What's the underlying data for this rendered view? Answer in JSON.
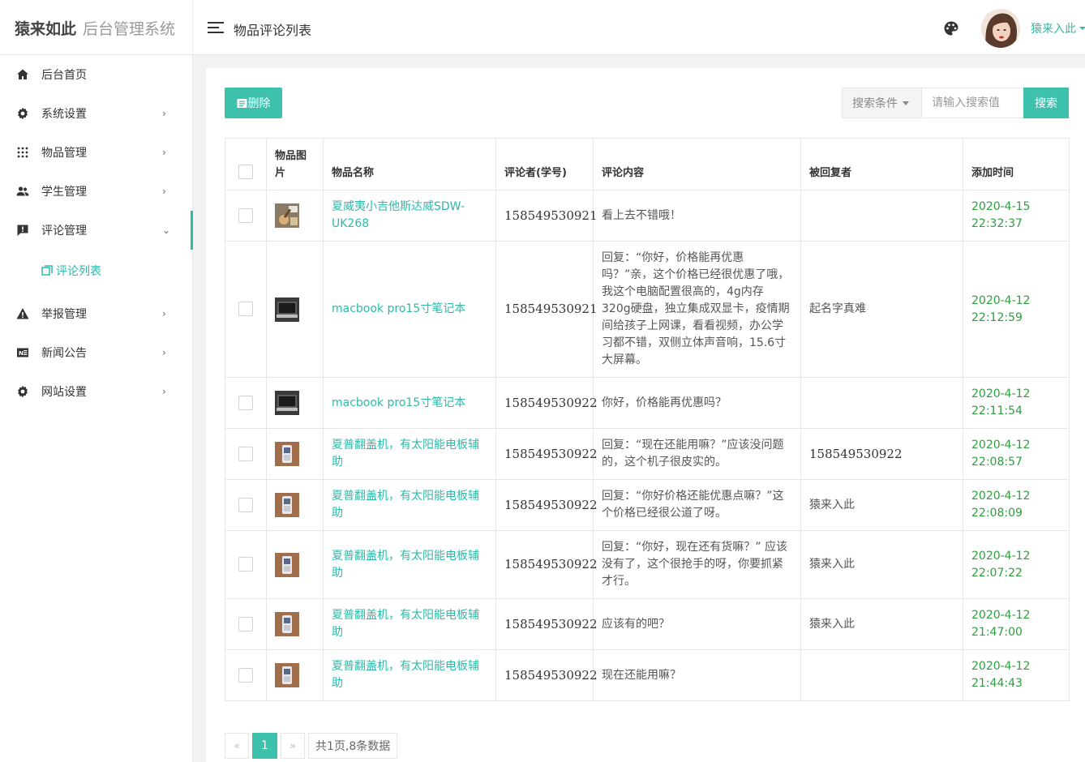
{
  "header": {
    "brand_main": "猿来如此",
    "brand_sub": "后台管理系统",
    "page_title": "物品评论列表",
    "user_name": "猿来入此"
  },
  "sidebar": {
    "items": [
      {
        "label": "后台首页",
        "icon": "home-icon"
      },
      {
        "label": "系统设置",
        "icon": "gear-icon"
      },
      {
        "label": "物品管理",
        "icon": "grid-icon"
      },
      {
        "label": "学生管理",
        "icon": "users-icon"
      },
      {
        "label": "评论管理",
        "icon": "comment-icon"
      },
      {
        "label": "举报管理",
        "icon": "warning-icon"
      },
      {
        "label": "新闻公告",
        "icon": "news-icon"
      },
      {
        "label": "网站设置",
        "icon": "gear-icon"
      }
    ],
    "sub_item": {
      "label": "评论列表",
      "icon": "list-icon"
    }
  },
  "toolbar": {
    "delete_label": "删除",
    "search_select": "搜索条件",
    "search_placeholder": "请输入搜索值",
    "search_button": "搜索"
  },
  "table": {
    "headers": [
      "物品图片",
      "物品名称",
      "评论者(学号)",
      "评论内容",
      "被回复者",
      "添加时间"
    ],
    "rows": [
      {
        "name": "夏威夷小吉他斯达威SDW-UK268",
        "commenter": "158549530921",
        "content": "看上去不错哦！",
        "reply_to": "",
        "date": "2020-4-15",
        "time": "22:32:37"
      },
      {
        "name": "macbook pro15寸笔记本",
        "commenter": "158549530921",
        "content": "回复：“你好，价格能再优惠吗？”亲，这个价格已经很优惠了哦，我这个电脑配置很高的，4g内存 320g硬盘，独立集成双显卡，疫情期间给孩子上网课，看看视频，办公学习都不错，双侧立体声音响，15.6寸大屏幕。",
        "reply_to": "起名字真难",
        "date": "2020-4-12",
        "time": "22:12:59"
      },
      {
        "name": "macbook pro15寸笔记本",
        "commenter": "158549530922",
        "content": "你好，价格能再优惠吗？",
        "reply_to": "",
        "date": "2020-4-12",
        "time": "22:11:54"
      },
      {
        "name": "夏普翻盖机，有太阳能电板辅助",
        "commenter": "158549530922",
        "content": "回复：“现在还能用嘛？”应该没问题的，这个机子很皮实的。",
        "reply_to": "158549530922",
        "date": "2020-4-12",
        "time": "22:08:57"
      },
      {
        "name": "夏普翻盖机，有太阳能电板辅助",
        "commenter": "158549530922",
        "content": "回复：“你好价格还能优惠点嘛？”这个价格已经很公道了呀。",
        "reply_to": "猿来入此",
        "date": "2020-4-12",
        "time": "22:08:09"
      },
      {
        "name": "夏普翻盖机，有太阳能电板辅助",
        "commenter": "158549530922",
        "content": "回复：“你好，现在还有货嘛？” 应该没有了，这个很抢手的呀，你要抓紧才行。",
        "reply_to": "猿来入此",
        "date": "2020-4-12",
        "time": "22:07:22"
      },
      {
        "name": "夏普翻盖机，有太阳能电板辅助",
        "commenter": "158549530922",
        "content": "应该有的吧？",
        "reply_to": "猿来入此",
        "date": "2020-4-12",
        "time": "21:47:00"
      },
      {
        "name": "夏普翻盖机，有太阳能电板辅助",
        "commenter": "158549530922",
        "content": "现在还能用嘛？",
        "reply_to": "",
        "date": "2020-4-12",
        "time": "21:44:43"
      }
    ]
  },
  "pagination": {
    "prev": "«",
    "current": "1",
    "next": "»",
    "info": "共1页,8条数据"
  },
  "colors": {
    "accent": "#3dc1ad",
    "link": "#2ebaa8",
    "time": "#2e9e3f"
  }
}
